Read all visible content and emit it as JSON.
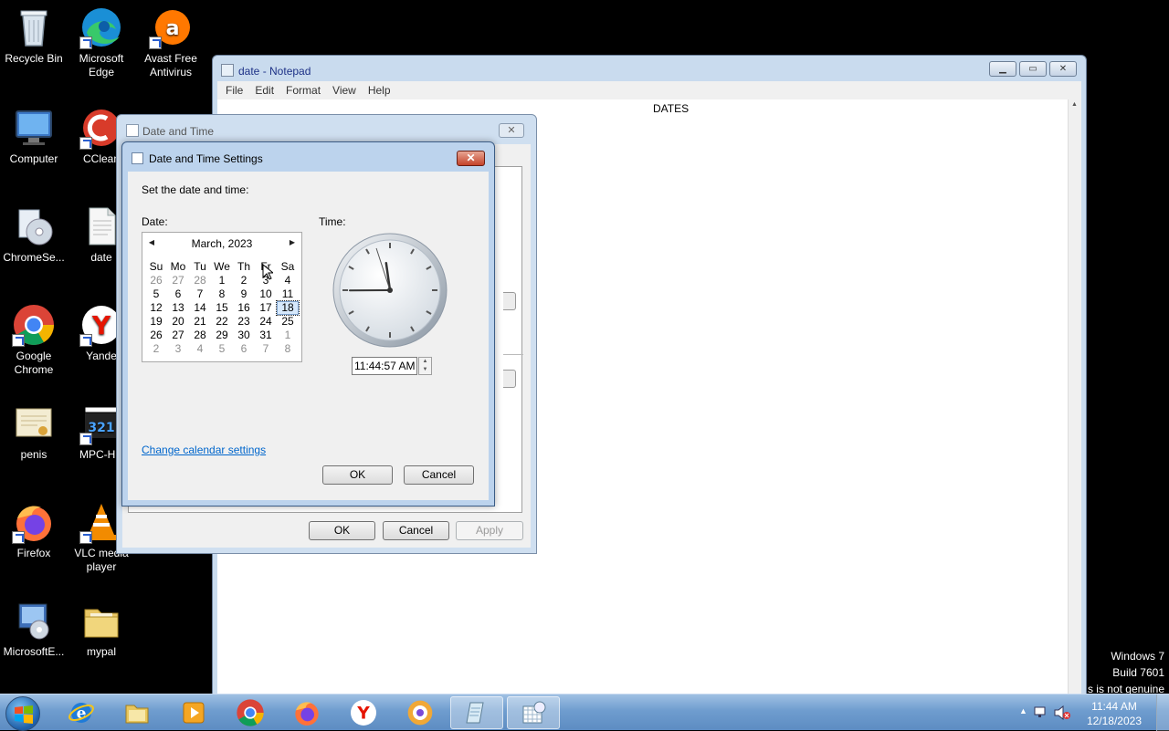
{
  "desktop": {
    "icons": [
      {
        "label": "Recycle Bin",
        "icon": "recycle-bin-icon"
      },
      {
        "label": "Microsoft Edge",
        "icon": "edge-icon"
      },
      {
        "label": "Avast Free Antivirus",
        "icon": "avast-icon"
      },
      {
        "label": "Computer",
        "icon": "computer-icon"
      },
      {
        "label": "CClean",
        "icon": "ccleaner-icon"
      },
      {
        "label": "ChromeSe...",
        "icon": "chrome-setup-icon"
      },
      {
        "label": "date",
        "icon": "text-file-icon"
      },
      {
        "label": "Google Chrome",
        "icon": "chrome-icon"
      },
      {
        "label": "Yande",
        "icon": "yandex-icon"
      },
      {
        "label": "penis",
        "icon": "certificate-icon"
      },
      {
        "label": "MPC-HC",
        "icon": "mpc-hc-icon"
      },
      {
        "label": "Firefox",
        "icon": "firefox-icon"
      },
      {
        "label": "VLC media player",
        "icon": "vlc-icon"
      },
      {
        "label": "MicrosoftE...",
        "icon": "installer-icon"
      },
      {
        "label": "mypal",
        "icon": "folder-icon"
      }
    ]
  },
  "notepad": {
    "title": "date - Notepad",
    "menu": [
      "File",
      "Edit",
      "Format",
      "View",
      "Help"
    ],
    "content": "DATES"
  },
  "date_time_dialog": {
    "title": "Date and Time",
    "close": "✕",
    "ok": "OK",
    "cancel": "Cancel",
    "apply": "Apply"
  },
  "settings_dialog": {
    "title": "Date and Time Settings",
    "close": "✕",
    "prompt": "Set the date and time:",
    "date_label": "Date:",
    "time_label": "Time:",
    "calendar": {
      "month": "March, 2023",
      "weekdays": [
        "Su",
        "Mo",
        "Tu",
        "We",
        "Th",
        "Fr",
        "Sa"
      ],
      "weeks": [
        [
          "26",
          "27",
          "28",
          "1",
          "2",
          "3",
          "4"
        ],
        [
          "5",
          "6",
          "7",
          "8",
          "9",
          "10",
          "11"
        ],
        [
          "12",
          "13",
          "14",
          "15",
          "16",
          "17",
          "18"
        ],
        [
          "19",
          "20",
          "21",
          "22",
          "23",
          "24",
          "25"
        ],
        [
          "26",
          "27",
          "28",
          "29",
          "30",
          "31",
          "1"
        ],
        [
          "2",
          "3",
          "4",
          "5",
          "6",
          "7",
          "8"
        ]
      ],
      "selected": "18"
    },
    "time_value": "11:44:57 AM",
    "clock": {
      "hour": 11,
      "minute": 44,
      "second": 57
    },
    "link": "Change calendar settings",
    "ok": "OK",
    "cancel": "Cancel"
  },
  "watermark": {
    "line1": "Windows 7",
    "line2": "Build 7601",
    "line3": "s is not genuine"
  },
  "taskbar": {
    "items": [
      "ie-icon",
      "explorer-icon",
      "media-player-icon",
      "chrome-icon",
      "firefox-icon",
      "yandex-icon",
      "mypal-icon",
      "notepad-icon",
      "date-time-icon"
    ],
    "time": "11:44 AM",
    "date": "12/18/2023"
  }
}
